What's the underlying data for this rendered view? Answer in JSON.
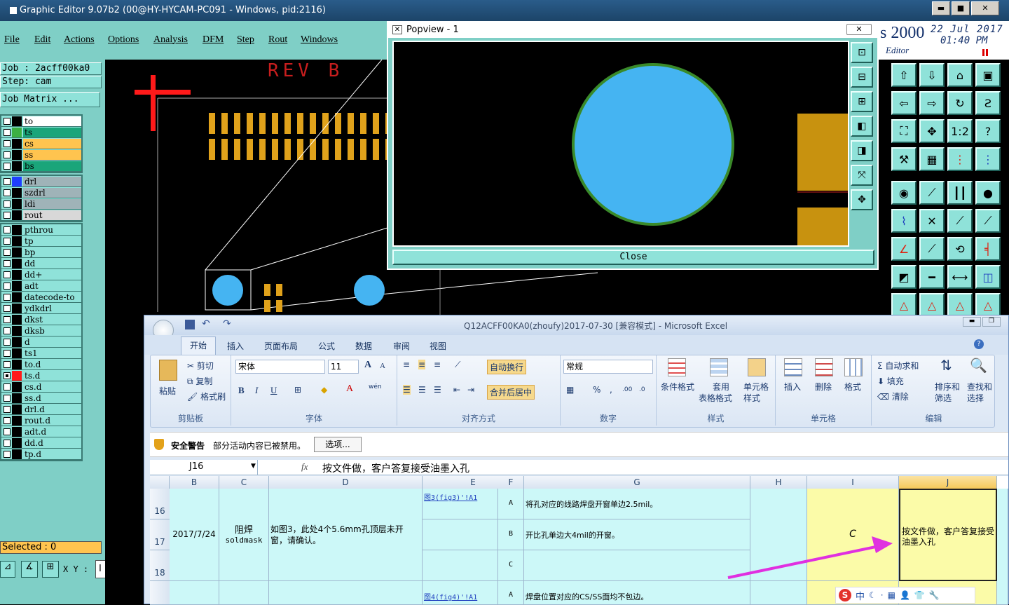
{
  "window": {
    "title": "Graphic Editor 9.07b2 (00@HY-HYCAM-PC091 - Windows, pid:2116)",
    "min": "▬",
    "max": "■",
    "close": "✕"
  },
  "menu": [
    "File",
    "Edit",
    "Actions",
    "Options",
    "Analysis",
    "DFM",
    "Step",
    "Rout",
    "Windows"
  ],
  "job": {
    "job_label": "Job : 2acff00ka0",
    "step_label": "Step: cam",
    "matrix_button": "Job Matrix ..."
  },
  "layers_group1": [
    {
      "name": "to",
      "swatch": "#000000",
      "color": "#ffffff"
    },
    {
      "name": "ts",
      "swatch": "#3cb043",
      "color": "#1aa57a"
    },
    {
      "name": "cs",
      "swatch": "#000000",
      "color": "#ffc44f"
    },
    {
      "name": "ss",
      "swatch": "#000000",
      "color": "#ffc44f"
    },
    {
      "name": "bs",
      "swatch": "#000000",
      "color": "#1aa57a"
    }
  ],
  "layers_group2": [
    {
      "name": "drl",
      "swatch": "#1f3fff",
      "color": "#9fb3b8"
    },
    {
      "name": "szdrl",
      "swatch": "#000000",
      "color": "#9fb3b8"
    },
    {
      "name": "ldi",
      "swatch": "#000000",
      "color": "#9fb3b8"
    },
    {
      "name": "rout",
      "swatch": "#000000",
      "color": "#d8d8d8"
    }
  ],
  "layers_group3": [
    {
      "name": "pthrou",
      "swatch": "#000000"
    },
    {
      "name": "tp",
      "swatch": "#000000"
    },
    {
      "name": "bp",
      "swatch": "#000000"
    },
    {
      "name": "dd",
      "swatch": "#000000"
    },
    {
      "name": "dd+",
      "swatch": "#000000"
    },
    {
      "name": "adt",
      "swatch": "#000000"
    },
    {
      "name": "datecode-to",
      "swatch": "#000000"
    },
    {
      "name": "ydkdrl",
      "swatch": "#000000"
    },
    {
      "name": "dkst",
      "swatch": "#000000"
    },
    {
      "name": "dksb",
      "swatch": "#000000"
    },
    {
      "name": "d",
      "swatch": "#000000"
    },
    {
      "name": "ts1",
      "swatch": "#000000"
    },
    {
      "name": "to.d",
      "swatch": "#000000"
    },
    {
      "name": "ts.d",
      "swatch": "#ff1a1a"
    },
    {
      "name": "cs.d",
      "swatch": "#000000"
    },
    {
      "name": "ss.d",
      "swatch": "#000000"
    },
    {
      "name": "drl.d",
      "swatch": "#000000"
    },
    {
      "name": "rout.d",
      "swatch": "#000000"
    },
    {
      "name": "adt.d",
      "swatch": "#000000"
    },
    {
      "name": "dd.d",
      "swatch": "#000000"
    },
    {
      "name": "tp.d",
      "swatch": "#000000"
    }
  ],
  "status": {
    "selected": "Selected : 0",
    "xy_label": "X Y :",
    "xy_value": "I"
  },
  "canvas": {
    "rev_text": "REV B"
  },
  "popup": {
    "title": "Popview - 1",
    "close_label": "Close"
  },
  "brand": {
    "name": "s 2000",
    "date": "22 Jul 2017",
    "time": "01:40 PM",
    "subtitle": "Editor"
  },
  "excel": {
    "title": "Q12ACFF00KA0(zhoufy)2017-07-30  [兼容模式] - Microsoft Excel",
    "tabs": [
      "开始",
      "插入",
      "页面布局",
      "公式",
      "数据",
      "审阅",
      "视图"
    ],
    "clipboard": {
      "paste": "粘贴",
      "cut": "剪切",
      "copy": "复制",
      "format_painter": "格式刷",
      "label": "剪贴板"
    },
    "font": {
      "name": "宋体",
      "size": "11",
      "label": "字体",
      "bold": "B",
      "italic": "I",
      "underline": "U",
      "grow": "A",
      "shrink": "A",
      "wen": "wén"
    },
    "align": {
      "wrap": "自动换行",
      "merge": "合并后居中",
      "label": "对齐方式"
    },
    "number": {
      "format": "常规",
      "percent": "%",
      "comma": ",",
      "inc": ".00",
      "dec": ".0",
      "label": "数字"
    },
    "styles": {
      "cond": "条件格式",
      "table": "套用",
      "table2": "表格格式",
      "cell": "单元格",
      "cell2": "样式",
      "label": "样式"
    },
    "cells": {
      "insert": "插入",
      "delete": "删除",
      "format": "格式",
      "label": "单元格"
    },
    "editing": {
      "autosum": "自动求和",
      "fill": "填充",
      "clear": "清除",
      "sort": "排序和",
      "sort2": "筛选",
      "find": "查找和",
      "find2": "选择",
      "label": "编辑"
    },
    "security": {
      "title": "安全警告",
      "message": "部分活动内容已被禁用。",
      "options": "选项..."
    },
    "namebox": "J16",
    "fx": "fx",
    "formula": "按文件做，客户答复接受油墨入孔",
    "columns": [
      "B",
      "C",
      "D",
      "E",
      "F",
      "G",
      "H",
      "I",
      "J"
    ],
    "rows": [
      "16",
      "17",
      "18"
    ],
    "data": {
      "date": "2017/7/24",
      "category": "阻焊",
      "category_en": "soldmask",
      "description": "如图3，此处4个5.6mm孔顶层未开窗，请确认。",
      "link1": "图3(fig3)'!A1",
      "link2": "图4(fig4)'!A1",
      "opt_a": "A",
      "opt_b": "B",
      "opt_c": "C",
      "opt_a2": "A",
      "ga": "将孔对应的线路焊盘开窗单边2.5mil。",
      "gb": "开比孔单边大4mil的开窗。",
      "g_next": "焊盘位置对应的CS/SS面均不包边。",
      "answer": "C",
      "reply": "按文件做，客户答复接受油墨入孔"
    },
    "ime": "中"
  }
}
